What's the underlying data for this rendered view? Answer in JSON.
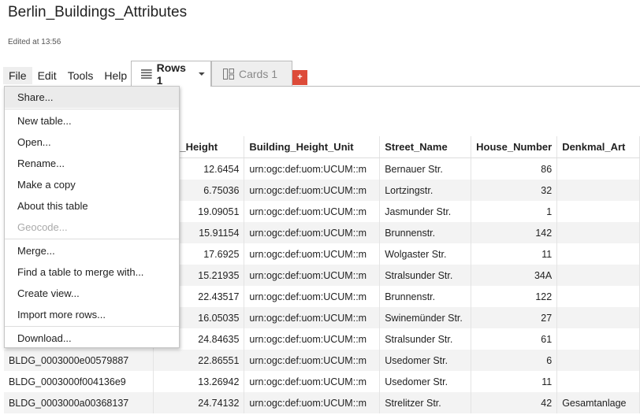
{
  "app": {
    "title": "Berlin_Buildings_Attributes",
    "edited": "Edited at 13:56"
  },
  "menubar": [
    "File",
    "Edit",
    "Tools",
    "Help"
  ],
  "tabs": {
    "rows_label": "Rows 1",
    "cards_label": "Cards 1",
    "add_label": "+"
  },
  "file_menu": {
    "groups": [
      [
        "Share..."
      ],
      [
        "New table...",
        "Open...",
        "Rename...",
        "Make a copy",
        "About this table",
        "Geocode..."
      ],
      [
        "Merge...",
        "Find a table to merge with...",
        "Create view...",
        "Import more rows..."
      ],
      [
        "Download..."
      ]
    ],
    "disabled": [
      "Geocode..."
    ],
    "highlighted": "Share..."
  },
  "table": {
    "columns": [
      "",
      "ding_Height",
      "Building_Height_Unit",
      "Street_Name",
      "House_Number",
      "Denkmal_Art"
    ],
    "rows": [
      [
        "",
        "12.6454",
        "urn:ogc:def:uom:UCUM::m",
        "Bernauer Str.",
        "86",
        ""
      ],
      [
        "",
        "6.75036",
        "urn:ogc:def:uom:UCUM::m",
        "Lortzingstr.",
        "32",
        ""
      ],
      [
        "",
        "19.09051",
        "urn:ogc:def:uom:UCUM::m",
        "Jasmunder Str.",
        "1",
        ""
      ],
      [
        "",
        "15.91154",
        "urn:ogc:def:uom:UCUM::m",
        "Brunnenstr.",
        "142",
        ""
      ],
      [
        "",
        "17.6925",
        "urn:ogc:def:uom:UCUM::m",
        "Wolgaster Str.",
        "11",
        ""
      ],
      [
        "",
        "15.21935",
        "urn:ogc:def:uom:UCUM::m",
        "Stralsunder Str.",
        "34A",
        ""
      ],
      [
        "",
        "22.43517",
        "urn:ogc:def:uom:UCUM::m",
        "Brunnenstr.",
        "122",
        ""
      ],
      [
        "",
        "16.05035",
        "urn:ogc:def:uom:UCUM::m",
        "Swinemünder Str.",
        "27",
        ""
      ],
      [
        "",
        "24.84635",
        "urn:ogc:def:uom:UCUM::m",
        "Stralsunder Str.",
        "61",
        ""
      ],
      [
        "BLDG_0003000e00579887",
        "22.86551",
        "urn:ogc:def:uom:UCUM::m",
        "Usedomer Str.",
        "6",
        ""
      ],
      [
        "BLDG_0003000f004136e9",
        "13.26942",
        "urn:ogc:def:uom:UCUM::m",
        "Usedomer Str.",
        "11",
        ""
      ],
      [
        "BLDG_0003000a00368137",
        "24.74132",
        "urn:ogc:def:uom:UCUM::m",
        "Strelitzer Str.",
        "42",
        "Gesamtanlage"
      ]
    ]
  }
}
